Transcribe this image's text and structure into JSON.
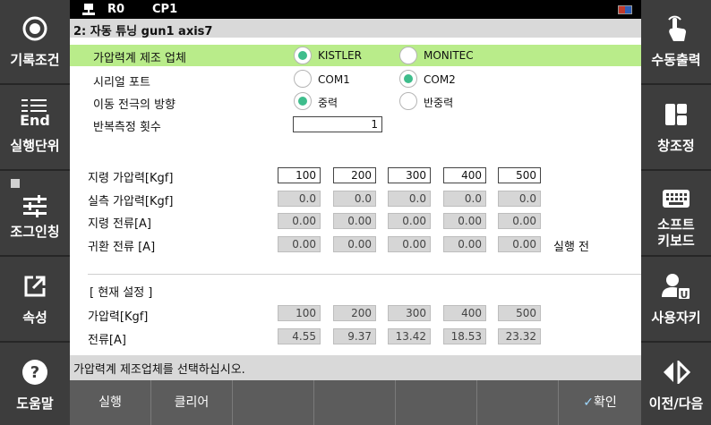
{
  "status": {
    "robot_icon": "robot-icon",
    "robot": "R0",
    "program": "CP1",
    "flag_icon": "flag-icon"
  },
  "title": "2: 자동 튜닝  gun1 axis7",
  "left_menu": [
    {
      "label": "기록조건",
      "icon": "record-icon"
    },
    {
      "label_line1": "End",
      "label": "실행단위",
      "icon": "list-icon"
    },
    {
      "label": "조그인칭",
      "icon": "sliders-icon"
    },
    {
      "label": "속성",
      "icon": "open-external-icon"
    },
    {
      "label": "도움말",
      "icon": "help-icon"
    }
  ],
  "right_menu": [
    {
      "label": "수동출력",
      "icon": "touch-hand-icon"
    },
    {
      "label": "창조정",
      "icon": "window-layout-icon"
    },
    {
      "label_line1": "소프트",
      "label_line2": "키보드",
      "icon": "keyboard-icon"
    },
    {
      "label": "사용자키",
      "icon": "user-key-icon"
    },
    {
      "label": "이전/다음",
      "icon": "prev-next-icon"
    }
  ],
  "form": {
    "manufacturer_label": "가압력계 제조 업체",
    "manufacturer_options": [
      "KISTLER",
      "MONITEC"
    ],
    "manufacturer_selected": "KISTLER",
    "serial_label": "시리얼 포트",
    "serial_options": [
      "COM1",
      "COM2"
    ],
    "serial_selected": "COM2",
    "direction_label": "이동 전극의 방향",
    "direction_options": [
      "중력",
      "반중력"
    ],
    "direction_selected": "중력",
    "repeat_label": "반복측정 횟수",
    "repeat_value": "1"
  },
  "table": {
    "rows": [
      {
        "label": "지령 가압력[Kgf]",
        "values": [
          "100",
          "200",
          "300",
          "400",
          "500"
        ],
        "editable": true
      },
      {
        "label": "실측 가압력[Kgf]",
        "values": [
          "0.0",
          "0.0",
          "0.0",
          "0.0",
          "0.0"
        ],
        "editable": false
      },
      {
        "label": "지령 전류[A]",
        "values": [
          "0.00",
          "0.00",
          "0.00",
          "0.00",
          "0.00"
        ],
        "editable": false
      },
      {
        "label": "귀환 전류 [A]",
        "values": [
          "0.00",
          "0.00",
          "0.00",
          "0.00",
          "0.00"
        ],
        "editable": false
      }
    ],
    "status_text": "실행 전"
  },
  "current": {
    "heading": "[ 현재 설정 ]",
    "rows": [
      {
        "label": "가압력[Kgf]",
        "values": [
          "100",
          "200",
          "300",
          "400",
          "500"
        ]
      },
      {
        "label": "전류[A]",
        "values": [
          "4.55",
          "9.37",
          "13.42",
          "18.53",
          "23.32"
        ]
      }
    ]
  },
  "message": "가압력계 제조업체를 선택하십시오.",
  "bottom_buttons": [
    "실행",
    "클리어",
    "",
    "",
    "",
    "",
    "확인"
  ]
}
